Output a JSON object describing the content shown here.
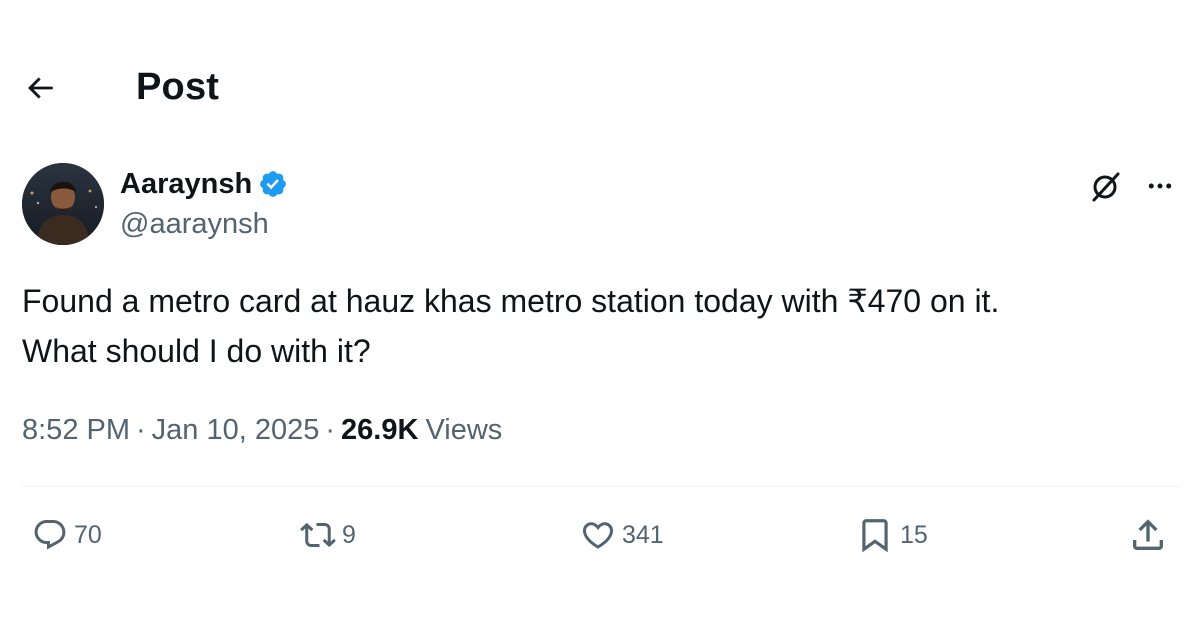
{
  "header": {
    "title": "Post",
    "back_icon": "arrow-left-icon"
  },
  "author": {
    "display_name": "Aaraynsh",
    "handle": "@aaraynsh",
    "verified": true,
    "verified_color": "#1d9bf0"
  },
  "post": {
    "lines": [
      "Found a metro card at hauz khas metro station today with ₹470 on it.",
      "What should I do with it?"
    ],
    "time": "8:52 PM",
    "separator": "·",
    "date": "Jan 10, 2025",
    "views_count": "26.9K",
    "views_label": "Views"
  },
  "actions": {
    "reply": {
      "icon": "reply-icon",
      "count": "70"
    },
    "repost": {
      "icon": "repost-icon",
      "count": "9"
    },
    "like": {
      "icon": "heart-icon",
      "count": "341"
    },
    "bookmark": {
      "icon": "bookmark-icon",
      "count": "15"
    },
    "share": {
      "icon": "share-icon"
    }
  },
  "colors": {
    "text": "#0f1419",
    "secondary": "#536471",
    "divider": "#eff3f4"
  }
}
